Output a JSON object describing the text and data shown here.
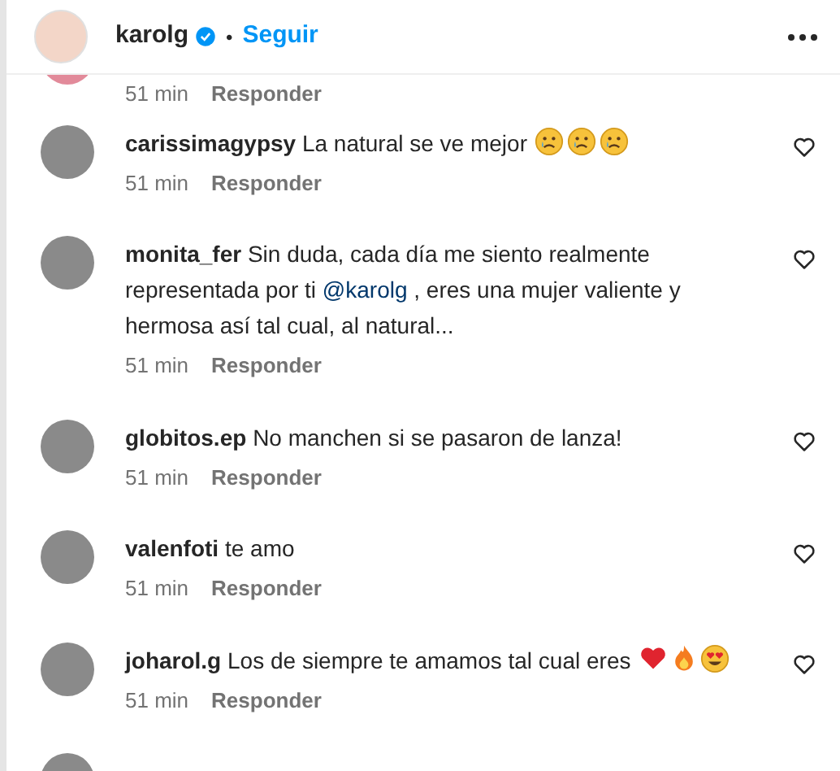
{
  "header": {
    "username": "karolg",
    "verified": true,
    "separator": "•",
    "follow": "Seguir"
  },
  "comments": [
    {
      "kind": "partial",
      "time": "51 min",
      "reply": "Responder"
    },
    {
      "kind": "full",
      "username": "carissimagypsy",
      "text": "La natural se ve mejor",
      "emojis": [
        {
          "kind": "sad"
        },
        {
          "kind": "sad"
        },
        {
          "kind": "sad"
        }
      ],
      "time": "51 min",
      "reply": "Responder"
    },
    {
      "kind": "full",
      "username": "monita_fer",
      "text_before": "Sin duda, cada día me siento realmente representada por ti",
      "mention": "@karolg",
      "text": ", eres una mujer valiente y hermosa así tal cual, al natural...",
      "time": "51 min",
      "reply": "Responder"
    },
    {
      "kind": "full",
      "username": "globitos.ep",
      "text": "No manchen si se pasaron de lanza!",
      "time": "51 min",
      "reply": "Responder"
    },
    {
      "kind": "full",
      "username": "valenfoti",
      "text": "te amo",
      "time": "51 min",
      "reply": "Responder"
    },
    {
      "kind": "full",
      "username": "joharol.g",
      "text": "Los de siempre te amamos tal cual eres",
      "emojis": [
        {
          "kind": "heart"
        },
        {
          "kind": "fire"
        },
        {
          "kind": "heart-eyes"
        }
      ],
      "time": "51 min",
      "reply": "Responder"
    },
    {
      "kind": "cut"
    }
  ]
}
